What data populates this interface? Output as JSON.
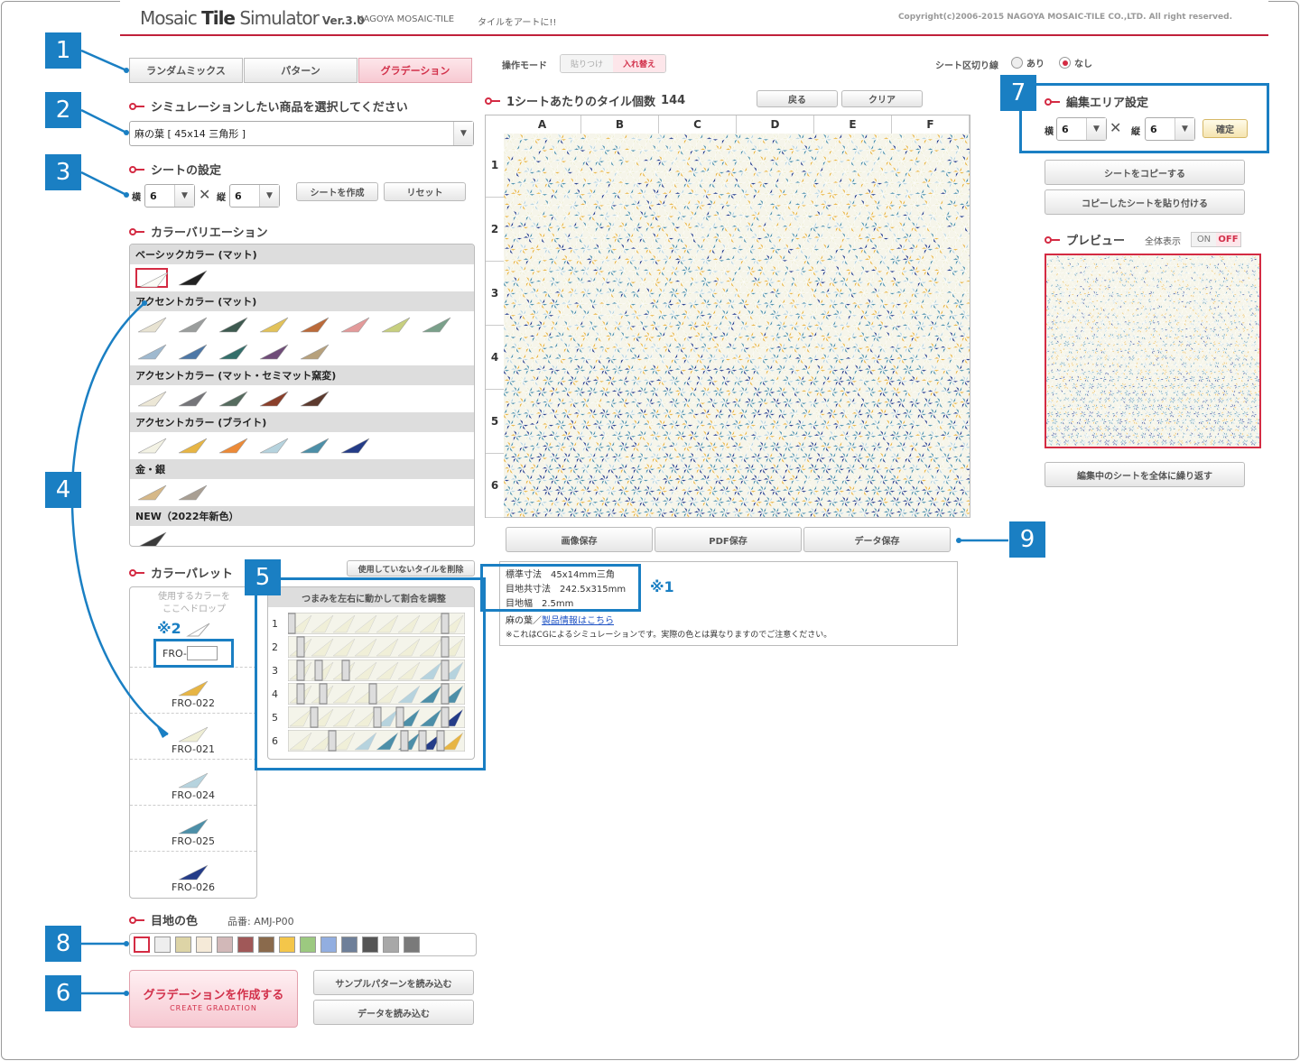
{
  "header": {
    "logo_main": "Mosaic ",
    "logo_bold": "Tile",
    "logo_rest": " Simulator",
    "version": "Ver.3.0",
    "company": "NAGOYA MOSAIC-TILE",
    "tagline": "タイルをアートに!!",
    "copyright": "Copyright(c)2006-2015 NAGOYA MOSAIC-TILE CO.,LTD. All right reserved."
  },
  "tabs": [
    "ランダムミックス",
    "パターン",
    "グラデーション"
  ],
  "op_mode": {
    "label": "操作モード",
    "options": [
      "貼りつけ",
      "入れ替え"
    ],
    "active": 1
  },
  "sheet_lines": {
    "label": "シート区切り線",
    "options": [
      "あり",
      "なし"
    ],
    "selected": 1
  },
  "product": {
    "title": "シミュレーションしたい商品を選択してください",
    "value": "麻の葉 [ 45x14 三角形 ]"
  },
  "sheet": {
    "title": "シートの設定",
    "w_label": "横",
    "h_label": "縦",
    "w": "6",
    "h": "6",
    "x": "✕",
    "create": "シートを作成",
    "reset": "リセット"
  },
  "colors": {
    "title": "カラーバリエーション",
    "groups": [
      {
        "name": "ベーシックカラー (マット)",
        "tiles": [
          [
            "#fbfbf6"
          ],
          [
            "#222222"
          ]
        ]
      },
      {
        "name": "アクセントカラー (マット)",
        "tiles": [
          [
            "#e8e3d2"
          ],
          [
            "#9a9d9c"
          ],
          [
            "#3e5a50"
          ],
          [
            "#e2c25a"
          ],
          [
            "#bb6a3a"
          ],
          [
            "#e39a9a"
          ],
          [
            "#c7cf7f"
          ],
          [
            "#7aa08a"
          ],
          [
            "#9fb9cf"
          ],
          [
            "#4d77a6"
          ],
          [
            "#336e6a"
          ],
          [
            "#6f4c78"
          ],
          [
            "#b7a17c"
          ]
        ]
      },
      {
        "name": "アクセントカラー (マット・セミマット窯変)",
        "tiles": [
          [
            "#ece7d6"
          ],
          [
            "#757579"
          ],
          [
            "#556b5e"
          ],
          [
            "#8a3f2a"
          ],
          [
            "#5c3a2e"
          ]
        ]
      },
      {
        "name": "アクセントカラー (ブライト)",
        "tiles": [
          [
            "#f3f2e4"
          ],
          [
            "#e7b544"
          ],
          [
            "#ec8a37"
          ],
          [
            "#b6d3de"
          ],
          [
            "#4c8fa8"
          ],
          [
            "#243c88"
          ]
        ]
      },
      {
        "name": "金・銀",
        "tiles": [
          [
            "#d6b888"
          ],
          [
            "#a99f93"
          ]
        ]
      },
      {
        "name": "NEW（2022年新色）",
        "tiles": [
          [
            "#3b3b3b"
          ]
        ]
      }
    ]
  },
  "grid": {
    "title": "1シートあたりのタイル個数",
    "count": "144",
    "back": "戻る",
    "clear": "クリア",
    "cols": [
      "A",
      "B",
      "C",
      "D",
      "E",
      "F"
    ],
    "rows": [
      "1",
      "2",
      "3",
      "4",
      "5",
      "6"
    ]
  },
  "save": {
    "image": "画像保存",
    "pdf": "PDF保存",
    "data": "データ保存"
  },
  "info": {
    "line1": "標準寸法　45x14mm三角",
    "line2": "目地共寸法　242.5x315mm",
    "line3": "目地幅　2.5mm",
    "note_mark": "※1",
    "product": "麻の葉／",
    "link": "製品情報はこちら",
    "note": "※これはCGによるシミュレーションです。実際の色とは異なりますのでご注意ください。"
  },
  "edit": {
    "title": "編集エリア設定",
    "w_label": "横",
    "h_label": "縦",
    "w": "6",
    "h": "6",
    "x": "✕",
    "confirm": "確定",
    "copy": "シートをコピーする",
    "paste": "コピーしたシートを貼り付ける"
  },
  "preview": {
    "title": "プレビュー",
    "full": "全体表示",
    "on": "ON",
    "off": "OFF",
    "repeat": "編集中のシートを全体に繰り返す"
  },
  "palette": {
    "title": "カラーパレット",
    "delete_unused": "使用していないタイルを削除",
    "drop_hint1": "使用するカラーを",
    "drop_hint2": "ここへドロップ",
    "mark2": "※2",
    "fro_prefix": "FRO-",
    "items": [
      {
        "code": "FRO-022",
        "color": "#e7b544"
      },
      {
        "code": "FRO-021",
        "color": "#efeed5"
      },
      {
        "code": "FRO-024",
        "color": "#b6d3de"
      },
      {
        "code": "FRO-025",
        "color": "#4c8fa8"
      },
      {
        "code": "FRO-026",
        "color": "#243c88"
      }
    ]
  },
  "ratio": {
    "title": "つまみを左右に動かして割合を調整",
    "rows": [
      "1",
      "2",
      "3",
      "4",
      "5",
      "6"
    ]
  },
  "joint": {
    "title": "目地の色",
    "code_label": "品番: AMJ-P00",
    "colors": [
      "#ffffff",
      "#eeeeee",
      "#ddd4a6",
      "#f5ead8",
      "#d2b8b8",
      "#a05858",
      "#8a6a4c",
      "#f4c64a",
      "#9cc980",
      "#92aee0",
      "#6e7f99",
      "#555555",
      "#a8a8a8",
      "#7a7a7a"
    ]
  },
  "actions": {
    "create": "グラデーションを作成する",
    "create_sub": "CREATE GRADATION",
    "sample": "サンプルパターンを読み込む",
    "load": "データを読み込む"
  },
  "callouts": [
    "1",
    "2",
    "3",
    "4",
    "5",
    "6",
    "7",
    "8",
    "9"
  ]
}
